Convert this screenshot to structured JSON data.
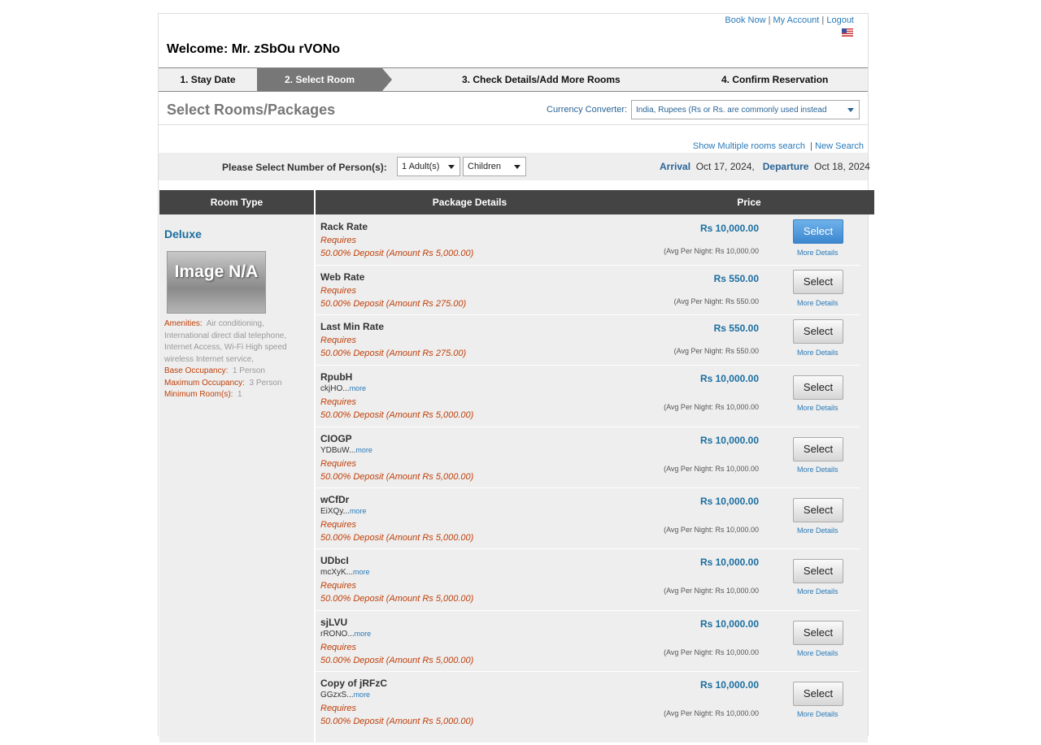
{
  "header": {
    "links": [
      "Book Now",
      "My Account",
      "Logout"
    ],
    "welcome": "Welcome: Mr. zSbOu rVONo"
  },
  "steps": [
    {
      "label": "1. Stay Date",
      "active": false
    },
    {
      "label": "2. Select Room",
      "active": true
    },
    {
      "label": "3. Check Details/Add More Rooms",
      "active": false
    },
    {
      "label": "4. Confirm Reservation",
      "active": false
    }
  ],
  "page_title": "Select Rooms/Packages",
  "currency": {
    "label": "Currency Converter:",
    "selected": "India, Rupees (Rs or Rs. are commonly used instead"
  },
  "search_links": {
    "multiple": "Show Multiple rooms search",
    "separator": "|",
    "new_search": "New Search"
  },
  "persons": {
    "label": "Please Select Number of Person(s):",
    "adults": "1 Adult(s)",
    "children": "Children",
    "arrival_label": "Arrival",
    "arrival_date": "Oct 17, 2024,",
    "departure_label": "Departure",
    "departure_date": "Oct 18, 2024"
  },
  "table_headers": {
    "room_type": "Room Type",
    "package_details": "Package Details",
    "price": "Price"
  },
  "room": {
    "name": "Deluxe",
    "image_text": "Image N/A",
    "amenities_label": "Amenities:",
    "amenities": "Air conditioning, International direct dial telephone, Internet Access, Wi-Fi High speed wireless Internet service,",
    "base_occupancy_label": "Base Occupancy:",
    "base_occupancy": "1 Person",
    "max_occupancy_label": "Maximum Occupancy:",
    "max_occupancy": "3 Person",
    "min_rooms_label": "Minimum Room(s):",
    "min_rooms": "1"
  },
  "packages": [
    {
      "name": "Rack Rate",
      "desc": "",
      "requires": "Requires",
      "deposit": "50.00% Deposit (Amount Rs 5,000.00)",
      "price": "Rs 10,000.00",
      "avg": "(Avg Per Night: Rs 10,000.00",
      "button": "Select",
      "details": "More Details"
    },
    {
      "name": "Web Rate",
      "desc": "",
      "requires": "Requires",
      "deposit": "50.00% Deposit (Amount Rs 275.00)",
      "price": "Rs 550.00",
      "avg": "(Avg Per Night: Rs 550.00",
      "button": "Select",
      "details": "More Details"
    },
    {
      "name": "Last Min Rate",
      "desc": "",
      "requires": "Requires",
      "deposit": "50.00% Deposit (Amount Rs 275.00)",
      "price": "Rs 550.00",
      "avg": "(Avg Per Night: Rs 550.00",
      "button": "Select",
      "details": "More Details"
    },
    {
      "name": "RpubH",
      "desc": "ckjHO...",
      "more": "more",
      "requires": "Requires",
      "deposit": "50.00% Deposit (Amount Rs 5,000.00)",
      "price": "Rs 10,000.00",
      "avg": "(Avg Per Night: Rs 10,000.00",
      "button": "Select",
      "details": "More Details"
    },
    {
      "name": "CIOGP",
      "desc": "YDBuW...",
      "more": "more",
      "requires": "Requires",
      "deposit": "50.00% Deposit (Amount Rs 5,000.00)",
      "price": "Rs 10,000.00",
      "avg": "(Avg Per Night: Rs 10,000.00",
      "button": "Select",
      "details": "More Details"
    },
    {
      "name": "wCfDr",
      "desc": "EiXQy...",
      "more": "more",
      "requires": "Requires",
      "deposit": "50.00% Deposit (Amount Rs 5,000.00)",
      "price": "Rs 10,000.00",
      "avg": "(Avg Per Night: Rs 10,000.00",
      "button": "Select",
      "details": "More Details"
    },
    {
      "name": "UDbcI",
      "desc": "mcXyK...",
      "more": "more",
      "requires": "Requires",
      "deposit": "50.00% Deposit (Amount Rs 5,000.00)",
      "price": "Rs 10,000.00",
      "avg": "(Avg Per Night: Rs 10,000.00",
      "button": "Select",
      "details": "More Details"
    },
    {
      "name": "sjLVU",
      "desc": "rRONO...",
      "more": "more",
      "requires": "Requires",
      "deposit": "50.00% Deposit (Amount Rs 5,000.00)",
      "price": "Rs 10,000.00",
      "avg": "(Avg Per Night: Rs 10,000.00",
      "button": "Select",
      "details": "More Details"
    },
    {
      "name": "Copy of jRFzC",
      "desc": "GGzxS...",
      "more": "more",
      "requires": "Requires",
      "deposit": "50.00% Deposit (Amount Rs 5,000.00)",
      "price": "Rs 10,000.00",
      "avg": "(Avg Per Night: Rs 10,000.00",
      "button": "Select",
      "details": "More Details"
    }
  ],
  "colors": {
    "accent": "#1a6ea0",
    "step_active": "#777777",
    "header_bg": "#444444",
    "requires": "#c0400a",
    "primary_button": "#3b87d0"
  }
}
